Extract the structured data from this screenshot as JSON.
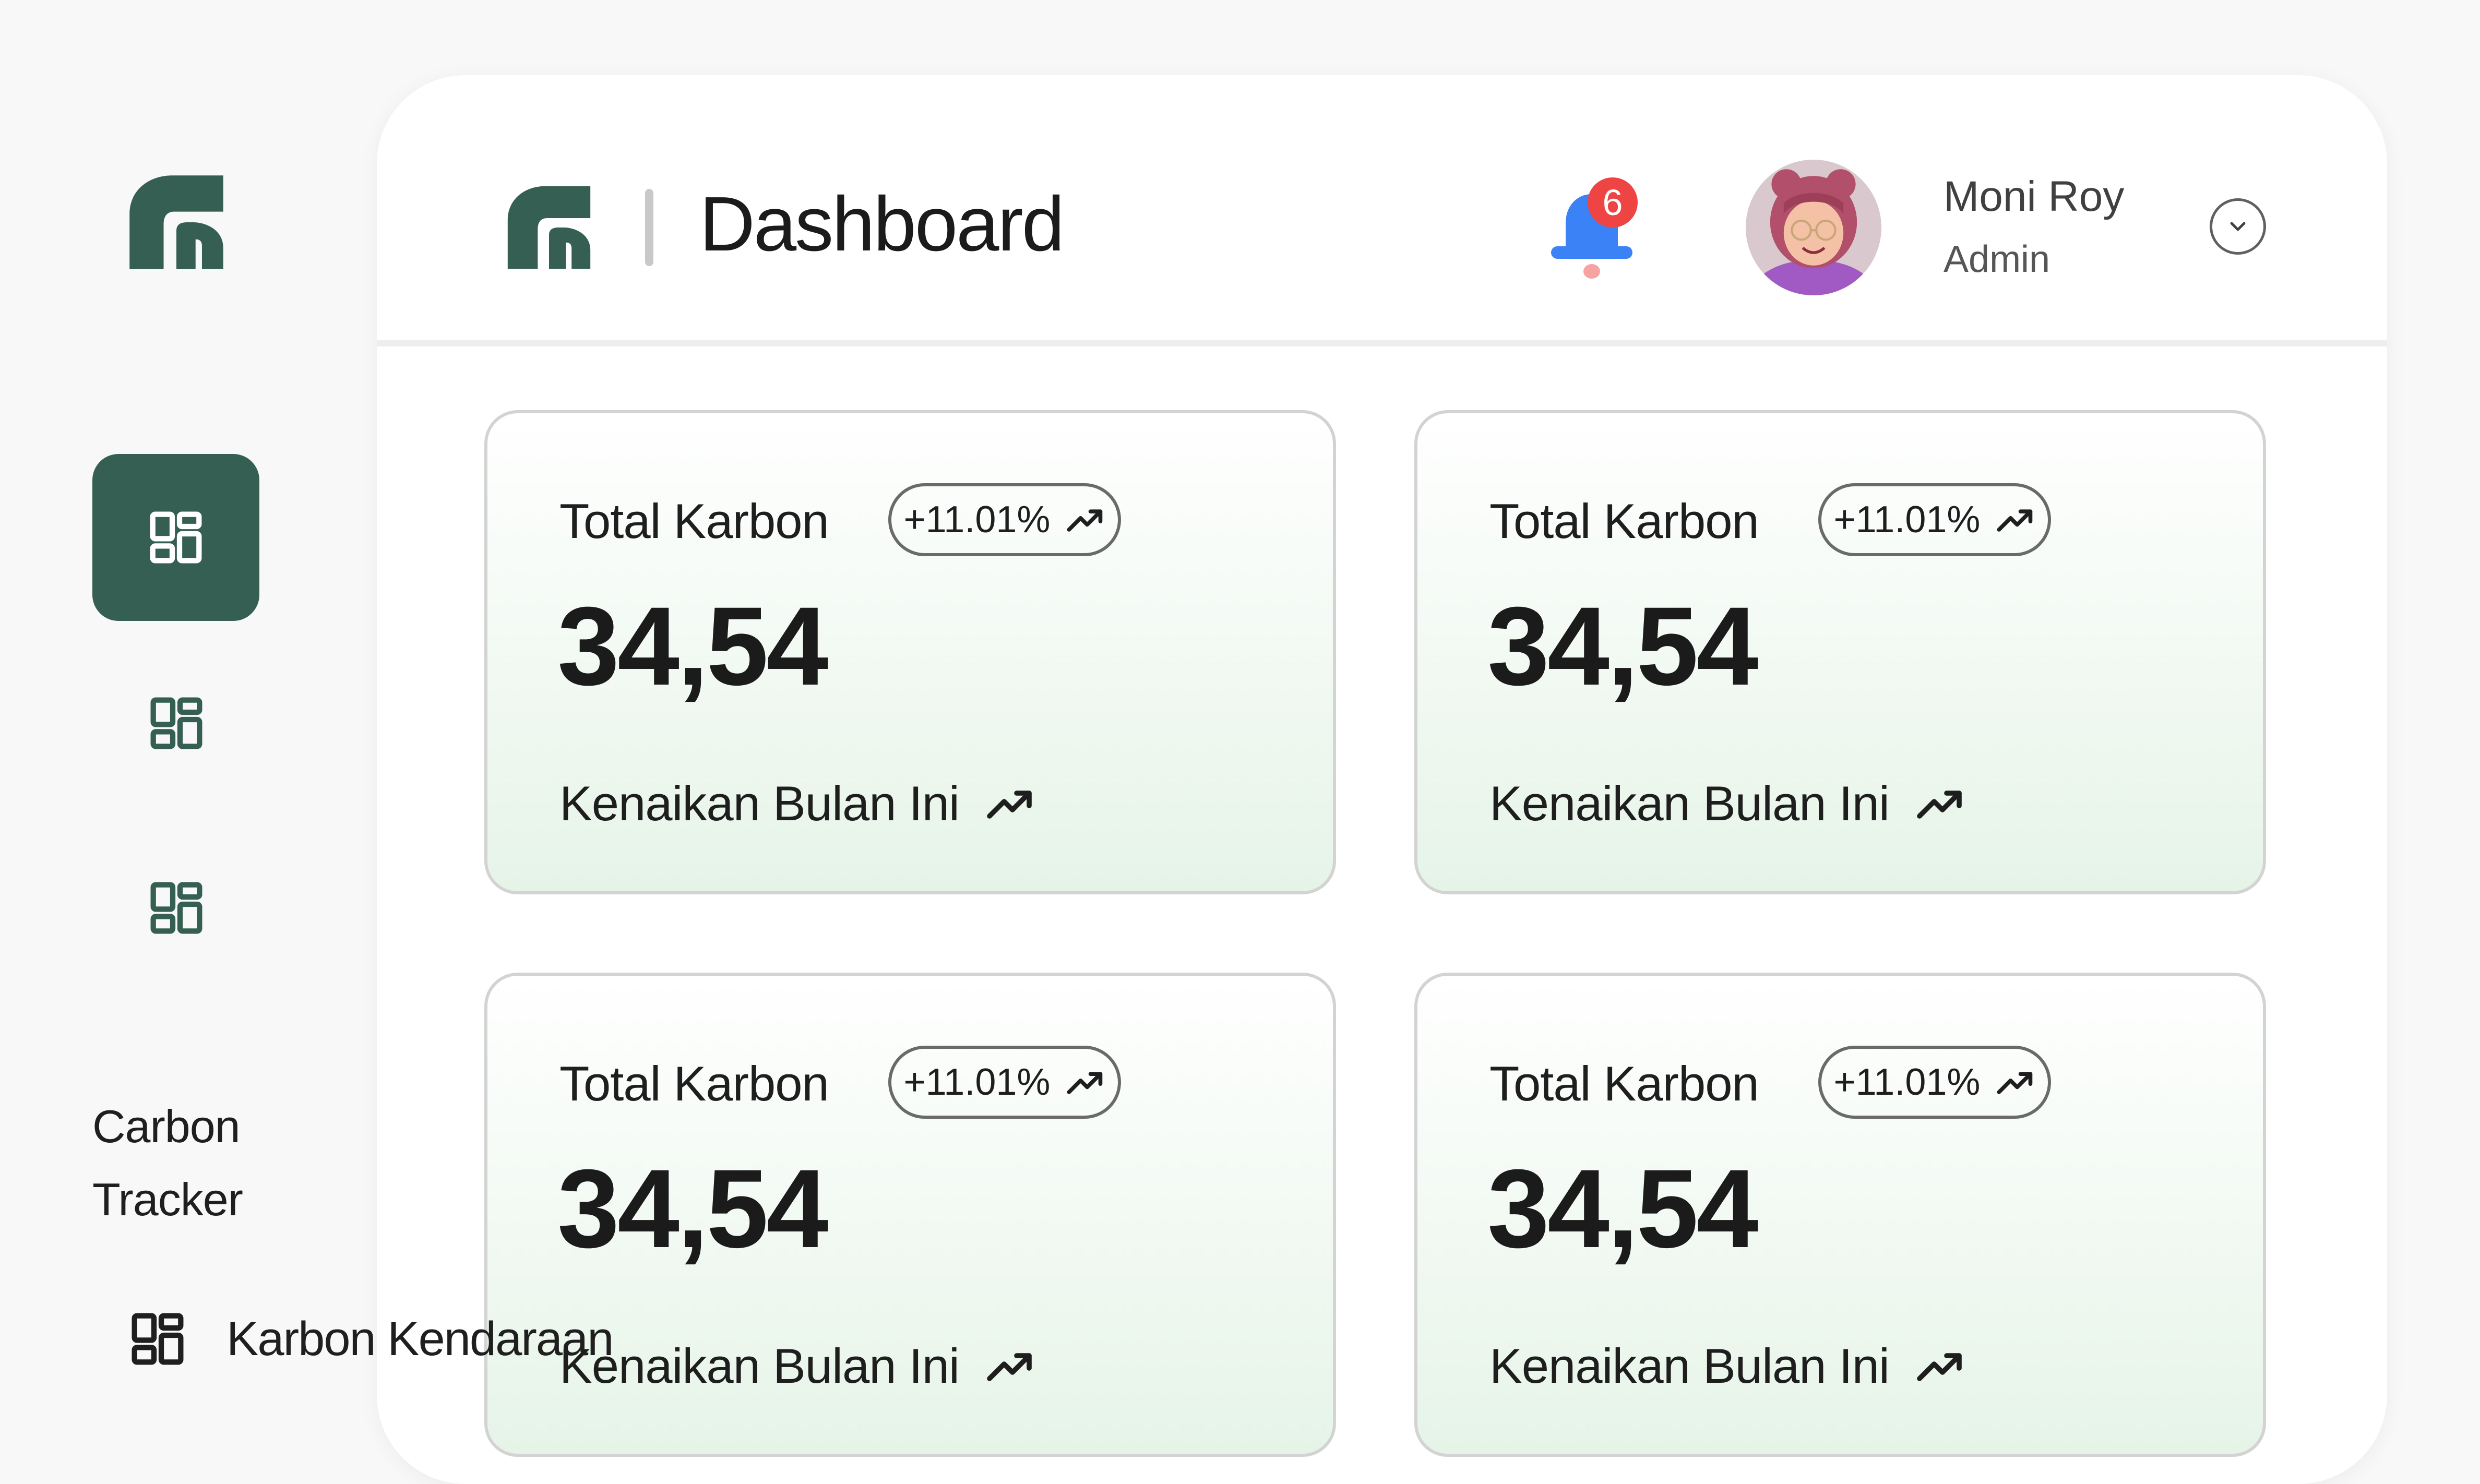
{
  "sidebar": {
    "app_name_line1": "Carbon",
    "app_name_line2": "Tracker",
    "sub_item_label": "Karbon Kendaraan"
  },
  "header": {
    "title": "Dashboard",
    "notification_count": "6",
    "user": {
      "name": "Moni Roy",
      "role": "Admin"
    }
  },
  "cards": [
    {
      "title": "Total Karbon",
      "change": "+11.01%",
      "value": "34,54",
      "footer": "Kenaikan Bulan Ini"
    },
    {
      "title": "Total Karbon",
      "change": "+11.01%",
      "value": "34,54",
      "footer": "Kenaikan Bulan Ini"
    },
    {
      "title": "Total Karbon",
      "change": "+11.01%",
      "value": "34,54",
      "footer": "Kenaikan Bulan Ini"
    },
    {
      "title": "Total Karbon",
      "change": "+11.01%",
      "value": "34,54",
      "footer": "Kenaikan Bulan Ini"
    }
  ],
  "colors": {
    "brand_green": "#355f53",
    "bell_blue": "#3b82f6",
    "badge_red": "#ef4444",
    "card_gradient_end": "#e6f4e8"
  },
  "icons": {
    "logo": "brand-logo",
    "nav": "dashboard-grid-icon",
    "trend": "trend-up-icon",
    "notifications": "bell-icon",
    "dropdown": "chevron-down-icon"
  }
}
